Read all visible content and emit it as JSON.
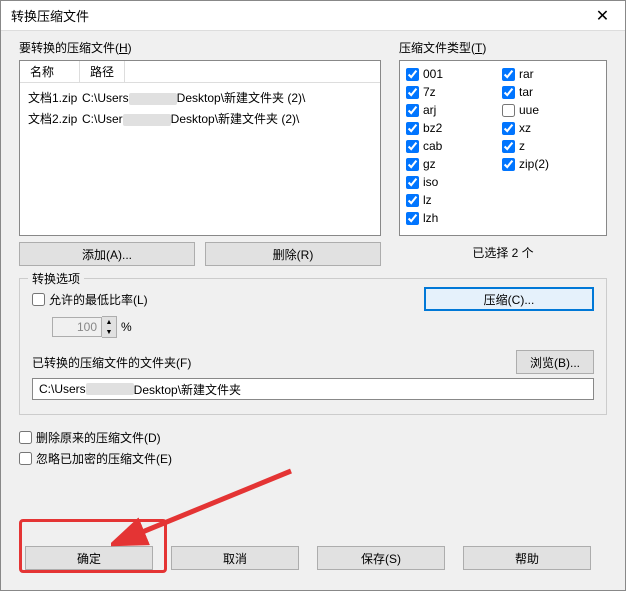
{
  "window": {
    "title": "转换压缩文件"
  },
  "filesPanel": {
    "label_pre": "要转换的压缩文件(",
    "label_key": "H",
    "label_post": ")",
    "col_name": "名称",
    "col_path": "路径",
    "rows": [
      {
        "name": "文档1.zip",
        "path_a": "C:\\Users",
        "path_b": "Desktop\\新建文件夹 (2)\\"
      },
      {
        "name": "文档2.zip",
        "path_a": "C:\\User",
        "path_b": "Desktop\\新建文件夹 (2)\\"
      }
    ],
    "add_btn": "添加(A)...",
    "del_btn": "删除(R)"
  },
  "typesPanel": {
    "label_pre": "压缩文件类型(",
    "label_key": "T",
    "label_post": ")",
    "items": [
      {
        "name": "001",
        "checked": true
      },
      {
        "name": "7z",
        "checked": true
      },
      {
        "name": "arj",
        "checked": true
      },
      {
        "name": "bz2",
        "checked": true
      },
      {
        "name": "cab",
        "checked": true
      },
      {
        "name": "gz",
        "checked": true
      },
      {
        "name": "iso",
        "checked": true
      },
      {
        "name": "lz",
        "checked": true
      },
      {
        "name": "lzh",
        "checked": true
      },
      {
        "name": "rar",
        "checked": true
      },
      {
        "name": "tar",
        "checked": true
      },
      {
        "name": "uue",
        "checked": false
      },
      {
        "name": "xz",
        "checked": true
      },
      {
        "name": "z",
        "checked": true
      },
      {
        "name": "zip(2)",
        "checked": true
      }
    ],
    "selected_text": "已选择 2 个"
  },
  "options": {
    "legend": "转换选项",
    "allow_low_ratio": "允许的最低比率(L)",
    "ratio_value": "100",
    "ratio_suffix": "%",
    "compress_btn": "压缩(C)..."
  },
  "folder": {
    "label": "已转换的压缩文件的文件夹(F)",
    "browse": "浏览(B)...",
    "path_a": "C:\\Users",
    "path_b": "Desktop\\新建文件夹"
  },
  "bottom_checks": {
    "delete_orig": "删除原来的压缩文件(D)",
    "ignore_encrypted": "忽略已加密的压缩文件(E)"
  },
  "buttons": {
    "ok": "确定",
    "cancel": "取消",
    "save": "保存(S)",
    "help": "帮助"
  }
}
